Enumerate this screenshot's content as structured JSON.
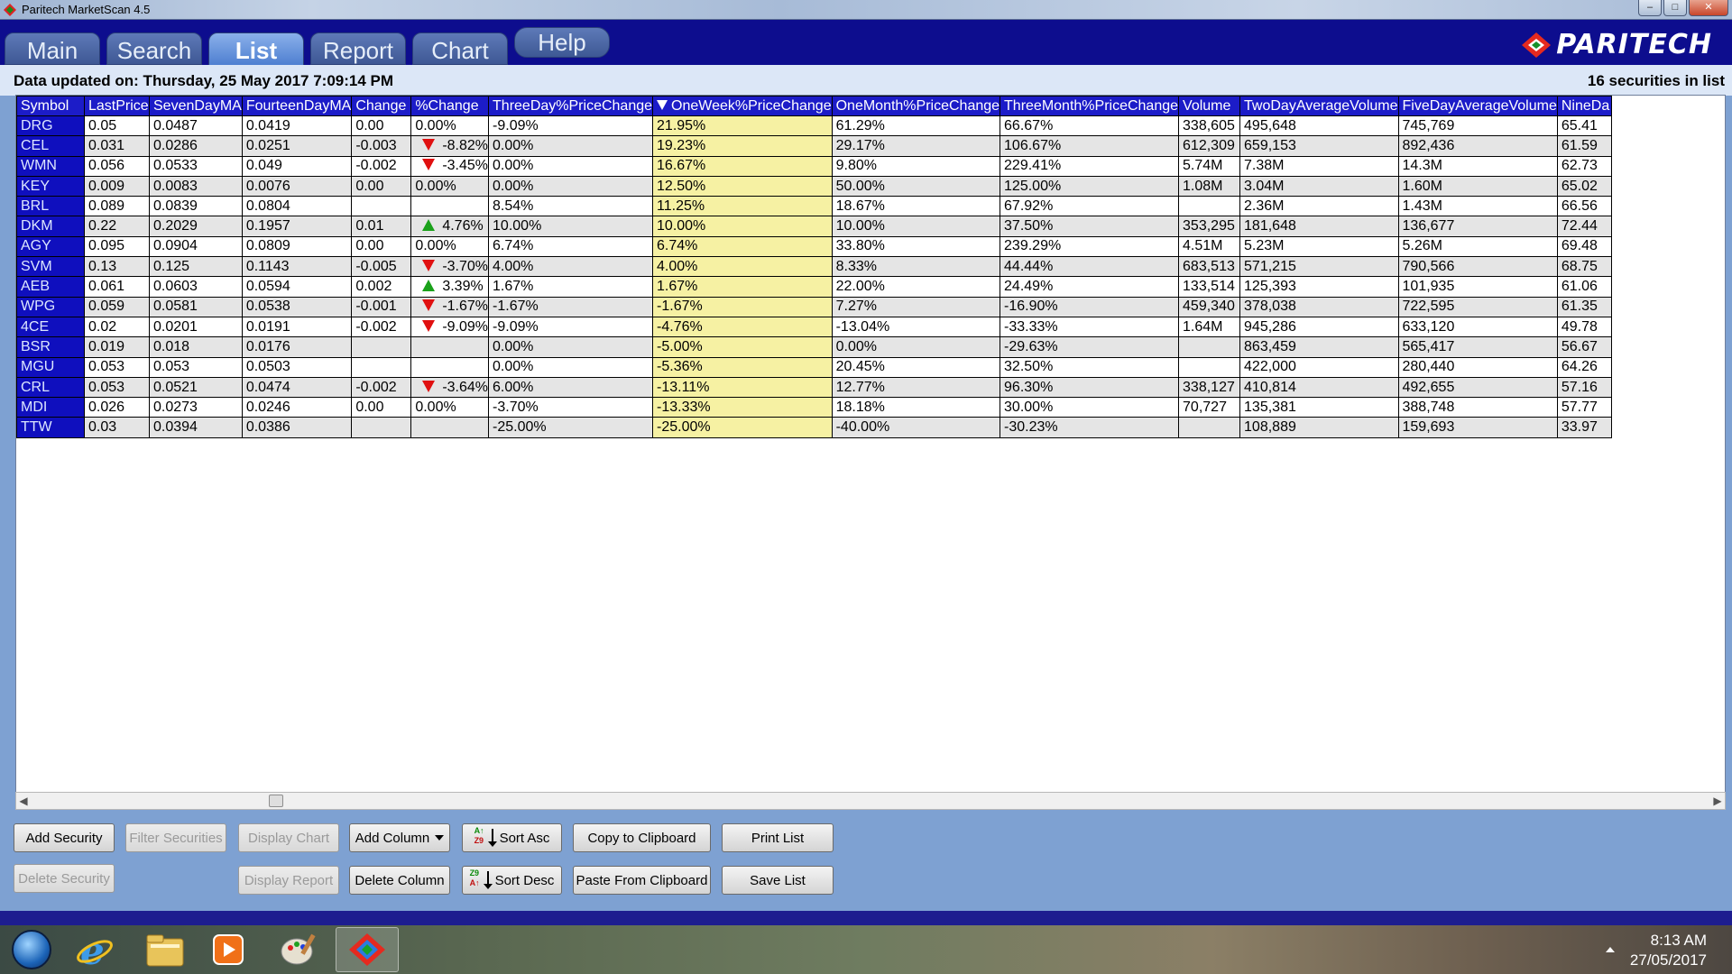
{
  "window": {
    "title": "Paritech MarketScan 4.5"
  },
  "tabs": [
    {
      "label": "Main"
    },
    {
      "label": "Search"
    },
    {
      "label": "List"
    },
    {
      "label": "Report"
    },
    {
      "label": "Chart"
    },
    {
      "label": "Help"
    }
  ],
  "brand": {
    "logo_text": "PARITECH"
  },
  "info": {
    "updated": "Data updated on: Thursday, 25 May 2017 7:09:14 PM",
    "count": "16 securities in list"
  },
  "table": {
    "sorted_column": "OneWeek%PriceChange",
    "columns": [
      "Symbol",
      "LastPrice",
      "SevenDayMA",
      "FourteenDayMA",
      "Change",
      "%Change",
      "ThreeDay%PriceChange",
      "OneWeek%PriceChange",
      "OneMonth%PriceChange",
      "ThreeMonth%PriceChange",
      "Volume",
      "TwoDayAverageVolume",
      "FiveDayAverageVolume",
      "NineDa"
    ],
    "rows": [
      [
        "DRG",
        "0.05",
        "0.0487",
        "0.0419",
        "0.00",
        "0.00%",
        "-9.09%",
        "21.95%",
        "61.29%",
        "66.67%",
        "338,605",
        "495,648",
        "745,769",
        "65.41"
      ],
      [
        "CEL",
        "0.031",
        "0.0286",
        "0.0251",
        "-0.003",
        "-8.82%",
        "0.00%",
        "19.23%",
        "29.17%",
        "106.67%",
        "612,309",
        "659,153",
        "892,436",
        "61.59"
      ],
      [
        "WMN",
        "0.056",
        "0.0533",
        "0.049",
        "-0.002",
        "-3.45%",
        "0.00%",
        "16.67%",
        "9.80%",
        "229.41%",
        "5.74M",
        "7.38M",
        "14.3M",
        "62.73"
      ],
      [
        "KEY",
        "0.009",
        "0.0083",
        "0.0076",
        "0.00",
        "0.00%",
        "0.00%",
        "12.50%",
        "50.00%",
        "125.00%",
        "1.08M",
        "3.04M",
        "1.60M",
        "65.02"
      ],
      [
        "BRL",
        "0.089",
        "0.0839",
        "0.0804",
        "",
        "",
        "8.54%",
        "11.25%",
        "18.67%",
        "67.92%",
        "",
        "2.36M",
        "1.43M",
        "66.56"
      ],
      [
        "DKM",
        "0.22",
        "0.2029",
        "0.1957",
        "0.01",
        "4.76%",
        "10.00%",
        "10.00%",
        "10.00%",
        "37.50%",
        "353,295",
        "181,648",
        "136,677",
        "72.44"
      ],
      [
        "AGY",
        "0.095",
        "0.0904",
        "0.0809",
        "0.00",
        "0.00%",
        "6.74%",
        "6.74%",
        "33.80%",
        "239.29%",
        "4.51M",
        "5.23M",
        "5.26M",
        "69.48"
      ],
      [
        "SVM",
        "0.13",
        "0.125",
        "0.1143",
        "-0.005",
        "-3.70%",
        "4.00%",
        "4.00%",
        "8.33%",
        "44.44%",
        "683,513",
        "571,215",
        "790,566",
        "68.75"
      ],
      [
        "AEB",
        "0.061",
        "0.0603",
        "0.0594",
        "0.002",
        "3.39%",
        "1.67%",
        "1.67%",
        "22.00%",
        "24.49%",
        "133,514",
        "125,393",
        "101,935",
        "61.06"
      ],
      [
        "WPG",
        "0.059",
        "0.0581",
        "0.0538",
        "-0.001",
        "-1.67%",
        "-1.67%",
        "-1.67%",
        "7.27%",
        "-16.90%",
        "459,340",
        "378,038",
        "722,595",
        "61.35"
      ],
      [
        "4CE",
        "0.02",
        "0.0201",
        "0.0191",
        "-0.002",
        "-9.09%",
        "-9.09%",
        "-4.76%",
        "-13.04%",
        "-33.33%",
        "1.64M",
        "945,286",
        "633,120",
        "49.78"
      ],
      [
        "BSR",
        "0.019",
        "0.018",
        "0.0176",
        "",
        "",
        "0.00%",
        "-5.00%",
        "0.00%",
        "-29.63%",
        "",
        "863,459",
        "565,417",
        "56.67"
      ],
      [
        "MGU",
        "0.053",
        "0.053",
        "0.0503",
        "",
        "",
        "0.00%",
        "-5.36%",
        "20.45%",
        "32.50%",
        "",
        "422,000",
        "280,440",
        "64.26"
      ],
      [
        "CRL",
        "0.053",
        "0.0521",
        "0.0474",
        "-0.002",
        "-3.64%",
        "6.00%",
        "-13.11%",
        "12.77%",
        "96.30%",
        "338,127",
        "410,814",
        "492,655",
        "57.16"
      ],
      [
        "MDI",
        "0.026",
        "0.0273",
        "0.0246",
        "0.00",
        "0.00%",
        "-3.70%",
        "-13.33%",
        "18.18%",
        "30.00%",
        "70,727",
        "135,381",
        "388,748",
        "57.77"
      ],
      [
        "TTW",
        "0.03",
        "0.0394",
        "0.0386",
        "",
        "",
        "-25.00%",
        "-25.00%",
        "-40.00%",
        "-30.23%",
        "",
        "108,889",
        "159,693",
        "33.97"
      ]
    ],
    "pct_arrows": [
      "",
      "down",
      "down",
      "",
      "",
      "up",
      "",
      "down",
      "up",
      "down",
      "down",
      "",
      "",
      "down",
      "",
      ""
    ]
  },
  "buttons": {
    "add_security": "Add Security",
    "filter_securities": "Filter Securities",
    "display_chart": "Display Chart",
    "add_column": "Add Column",
    "sort_asc": "Sort Asc",
    "copy_clipboard": "Copy to Clipboard",
    "print_list": "Print List",
    "delete_security": "Delete Security",
    "display_report": "Display Report",
    "delete_column": "Delete Column",
    "sort_desc": "Sort Desc",
    "paste_clipboard": "Paste From Clipboard",
    "save_list": "Save List"
  },
  "sort_icon": {
    "asc_top": "A↑",
    "asc_bottom": "Z9",
    "desc_top": "Z9",
    "desc_bottom": "A↑"
  },
  "taskbar": {
    "time": "8:13 AM",
    "date": "27/05/2017",
    "items": [
      "start-orb-icon",
      "internet-explorer-icon",
      "file-explorer-icon",
      "media-player-icon",
      "paint-icon",
      "paritech-icon"
    ]
  },
  "colors": {
    "header_navy": "#0d0d8e",
    "grid_header": "#1c1cc8",
    "sorted_column": "#f6f1a3",
    "up_arrow": "#1aa11a",
    "down_arrow": "#e01010"
  }
}
